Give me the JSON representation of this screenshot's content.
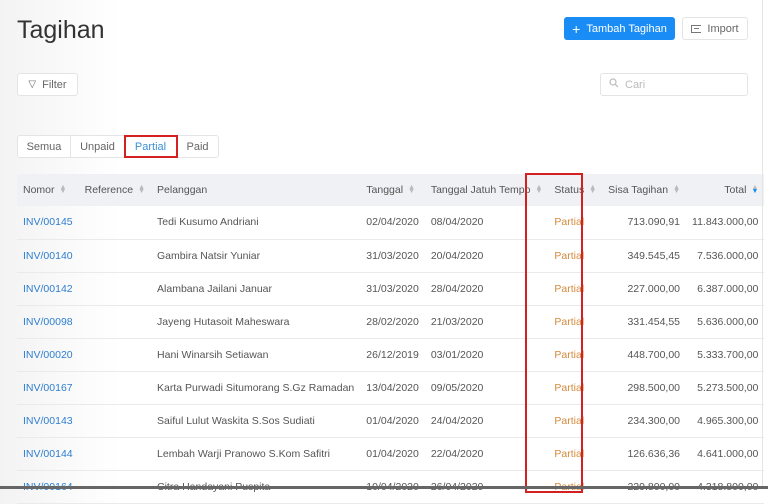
{
  "page": {
    "title": "Tagihan"
  },
  "toolbar": {
    "add_label": "Tambah Tagihan",
    "import_label": "Import",
    "filter_label": "Filter"
  },
  "search": {
    "placeholder": "Cari"
  },
  "tabs": [
    {
      "label": "Semua"
    },
    {
      "label": "Unpaid"
    },
    {
      "label": "Partial",
      "active": true
    },
    {
      "label": "Paid"
    }
  ],
  "table": {
    "headers": [
      "Nomor",
      "Reference",
      "Pelanggan",
      "Tanggal",
      "Tanggal Jatuh Tempo",
      "Status",
      "Sisa Tagihan",
      "Total"
    ],
    "rows": [
      [
        "INV/00145",
        "",
        "Tedi Kusumo Andriani",
        "02/04/2020",
        "08/04/2020",
        "Partial",
        "713.090,91",
        "11.843.000,00"
      ],
      [
        "INV/00140",
        "",
        "Gambira Natsir Yuniar",
        "31/03/2020",
        "20/04/2020",
        "Partial",
        "349.545,45",
        "7.536.000,00"
      ],
      [
        "INV/00142",
        "",
        "Alambana Jailani Januar",
        "31/03/2020",
        "28/04/2020",
        "Partial",
        "227.000,00",
        "6.387.000,00"
      ],
      [
        "INV/00098",
        "",
        "Jayeng Hutasoit Maheswara",
        "28/02/2020",
        "21/03/2020",
        "Partial",
        "331.454,55",
        "5.636.000,00"
      ],
      [
        "INV/00020",
        "",
        "Hani Winarsih Setiawan",
        "26/12/2019",
        "03/01/2020",
        "Partial",
        "448.700,00",
        "5.333.700,00"
      ],
      [
        "INV/00167",
        "",
        "Karta Purwadi Situmorang S.Gz Ramadan",
        "13/04/2020",
        "09/05/2020",
        "Partial",
        "298.500,00",
        "5.273.500,00"
      ],
      [
        "INV/00143",
        "",
        "Saiful Lulut Waskita S.Sos Sudiati",
        "01/04/2020",
        "24/04/2020",
        "Partial",
        "234.300,00",
        "4.965.300,00"
      ],
      [
        "INV/00144",
        "",
        "Lembah Warji Pranowo S.Kom Safitri",
        "01/04/2020",
        "22/04/2020",
        "Partial",
        "126.636,36",
        "4.641.000,00"
      ],
      [
        "INV/00164",
        "",
        "Citra Handayani Puspita",
        "10/04/2020",
        "26/04/2020",
        "Partial",
        "229.800,00",
        "4.318.800,00"
      ]
    ]
  },
  "colors": {
    "primary": "#1a8cf5",
    "link": "#2d7ed0",
    "partial": "#d48a3c",
    "highlight": "#d32020"
  }
}
